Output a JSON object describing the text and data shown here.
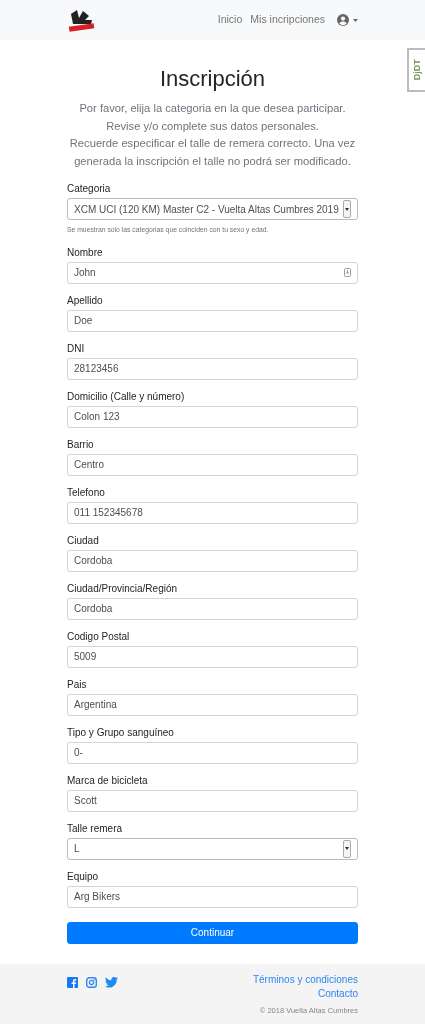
{
  "navbar": {
    "links": [
      {
        "label": "Inicio"
      },
      {
        "label": "Mis incripciones"
      }
    ]
  },
  "debug_tab": {
    "label": "DjDT"
  },
  "title": "Inscripción",
  "intro": [
    "Por favor, elija la categoria en la que desea participar.",
    "Revise y/o complete sus datos personales.",
    "Recuerde especificar el talle de remera correcto. Una vez generada la inscripción el talle no podrá ser modificado."
  ],
  "fields": [
    {
      "label": "Categoria",
      "kind": "select",
      "value": "XCM UCI (120 KM) Master C2 - Vuelta Altas Cumbres 2019",
      "help": "Se muestran solo las categorias que coinciden con tu sexo y edad."
    },
    {
      "label": "Nombre",
      "kind": "text",
      "value": "John",
      "autofill": true
    },
    {
      "label": "Apellido",
      "kind": "text",
      "value": "Doe"
    },
    {
      "label": "DNI",
      "kind": "text",
      "value": "28123456"
    },
    {
      "label": "Domicilio (Calle y número)",
      "kind": "text",
      "value": "Colon 123"
    },
    {
      "label": "Barrio",
      "kind": "text",
      "value": "Centro"
    },
    {
      "label": "Telefono",
      "kind": "text",
      "value": "011 152345678"
    },
    {
      "label": "Ciudad",
      "kind": "text",
      "value": "Cordoba"
    },
    {
      "label": "Ciudad/Provincia/Región",
      "kind": "text",
      "value": "Cordoba"
    },
    {
      "label": "Codigo Postal",
      "kind": "text",
      "value": "5009"
    },
    {
      "label": "Pais",
      "kind": "text",
      "value": "Argentina"
    },
    {
      "label": "Tipo y Grupo sanguíneo",
      "kind": "text",
      "value": "0-"
    },
    {
      "label": "Marca de bicicleta",
      "kind": "text",
      "value": "Scott"
    },
    {
      "label": "Talle remera",
      "kind": "select",
      "value": "L"
    },
    {
      "label": "Equipo",
      "kind": "text",
      "value": "Arg Bikers"
    }
  ],
  "submit": "Continuar",
  "footer": {
    "links": [
      {
        "label": "Términos y condiciones"
      },
      {
        "label": "Contacto"
      }
    ],
    "copyright": "© 2018 Vuelta Altas Cumbres"
  }
}
